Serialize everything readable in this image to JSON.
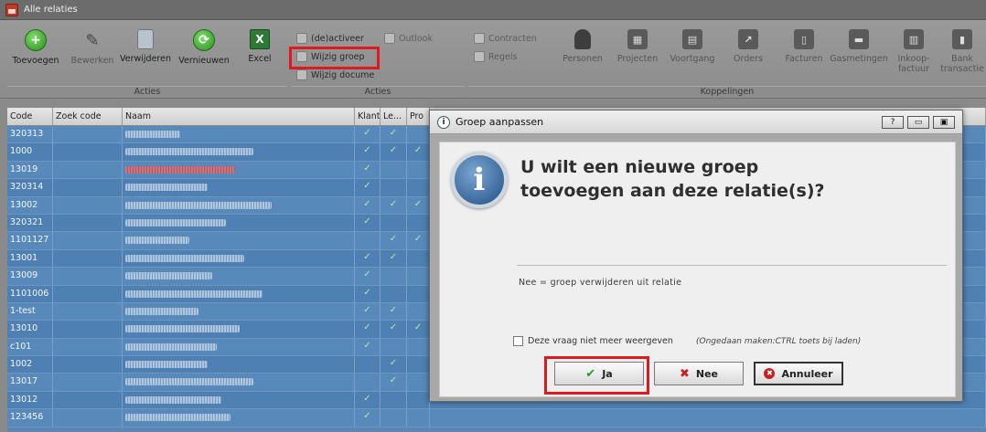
{
  "window": {
    "title": "Alle relaties"
  },
  "ribbon": {
    "acties_buttons": [
      {
        "label": "Toevoegen",
        "icon": "plus-circle-icon"
      },
      {
        "label": "Bewerken",
        "icon": "pencil-icon"
      },
      {
        "label": "Verwijderen",
        "icon": "recycle-bin-icon"
      },
      {
        "label": "Vernieuwen",
        "icon": "refresh-icon"
      },
      {
        "label": "Excel",
        "icon": "excel-icon"
      }
    ],
    "small_buttons": [
      {
        "label": "(de)activeer"
      },
      {
        "label": "Wijzig groep"
      },
      {
        "label": "Wijzig docume"
      },
      {
        "label": "Outlook"
      },
      {
        "label": "Contracten"
      },
      {
        "label": "Regels"
      }
    ],
    "koppeling_buttons": [
      {
        "label": "Personen"
      },
      {
        "label": "Projecten"
      },
      {
        "label": "Voortgang"
      },
      {
        "label": "Orders"
      },
      {
        "label": "Facturen"
      },
      {
        "label": "Gasmetingen"
      },
      {
        "label": "Inkoop-\nfactuur"
      },
      {
        "label": "Bank\ntransactie"
      }
    ],
    "groups": [
      "Acties",
      "Acties",
      "Koppelingen"
    ]
  },
  "grid": {
    "headers": [
      "Code",
      "Zoek code",
      "Naam",
      "Klant",
      "Le...",
      "Pro"
    ],
    "rows": [
      {
        "code": "320313",
        "klant": "✓",
        "le": "✓",
        "pro": ""
      },
      {
        "code": "1000",
        "klant": "✓",
        "le": "✓",
        "pro": "✓"
      },
      {
        "code": "13019",
        "klant": "✓",
        "le": "",
        "pro": "",
        "red": true
      },
      {
        "code": "320314",
        "klant": "✓",
        "le": "",
        "pro": ""
      },
      {
        "code": "13002",
        "klant": "✓",
        "le": "✓",
        "pro": "✓"
      },
      {
        "code": "320321",
        "klant": "✓",
        "le": "",
        "pro": ""
      },
      {
        "code": "1101127",
        "klant": "",
        "le": "✓",
        "pro": "✓"
      },
      {
        "code": "13001",
        "klant": "✓",
        "le": "✓",
        "pro": ""
      },
      {
        "code": "13009",
        "klant": "✓",
        "le": "",
        "pro": ""
      },
      {
        "code": "1101006",
        "klant": "✓",
        "le": "",
        "pro": ""
      },
      {
        "code": "1-test",
        "klant": "✓",
        "le": "✓",
        "pro": ""
      },
      {
        "code": "13010",
        "klant": "✓",
        "le": "✓",
        "pro": "✓"
      },
      {
        "code": "c101",
        "klant": "✓",
        "le": "",
        "pro": ""
      },
      {
        "code": "1002",
        "klant": "",
        "le": "✓",
        "pro": ""
      },
      {
        "code": "13017",
        "klant": "",
        "le": "✓",
        "pro": ""
      },
      {
        "code": "13012",
        "klant": "✓",
        "le": "",
        "pro": ""
      },
      {
        "code": "123456",
        "klant": "✓",
        "le": "",
        "pro": ""
      }
    ]
  },
  "dialog": {
    "title": "Groep aanpassen",
    "help_btn": "?",
    "question": "U wilt een nieuwe groep toevoegen aan deze relatie(s)?",
    "note": "Nee = groep verwijderen uit relatie",
    "checkbox_label": "Deze vraag niet meer weergeven",
    "hint": "(Ongedaan maken:CTRL toets bij laden)",
    "buttons": {
      "ja": "Ja",
      "nee": "Nee",
      "annuleer": "Annuleer"
    }
  }
}
